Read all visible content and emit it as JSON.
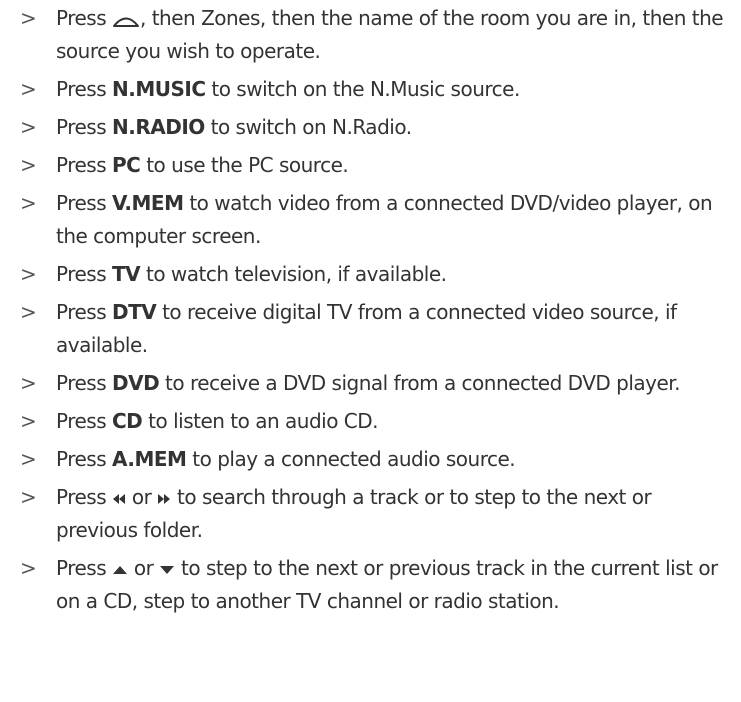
{
  "bullet": ">",
  "items": [
    {
      "pre": "Press ",
      "icon": "home-dome-icon",
      "post": ", then Zones, then the name of the room you are in, then the source you wish to operate."
    },
    {
      "pre": "Press ",
      "key": "N.MUSIC",
      "post": " to switch on the N.Music source."
    },
    {
      "pre": "Press ",
      "key": "N.RADIO",
      "post": " to switch on N.Radio."
    },
    {
      "pre": "Press ",
      "key": "PC",
      "post": " to use the PC source."
    },
    {
      "pre": "Press ",
      "key": "V.MEM",
      "post": " to watch video from a connected DVD/video player, on the computer screen."
    },
    {
      "pre": "Press ",
      "key": "TV",
      "post": " to watch television, if available."
    },
    {
      "pre": "Press ",
      "key": "DTV",
      "post": " to receive digital TV from a connected video source, if available."
    },
    {
      "pre": "Press ",
      "key": "DVD",
      "post": " to receive a DVD signal from a connected DVD player."
    },
    {
      "pre": "Press ",
      "key": "CD",
      "post": " to listen to an audio CD."
    },
    {
      "pre": "Press ",
      "key": "A.MEM",
      "post": " to play a connected audio source."
    },
    {
      "pre": "Press ",
      "icon": "rewind-icon",
      "mid": " or ",
      "icon2": "fast-forward-icon",
      "post": " to search through a track or to step to the next or previous folder."
    },
    {
      "pre": "Press ",
      "icon": "up-triangle-icon",
      "mid": " or ",
      "icon2": "down-triangle-icon",
      "post": " to step to the next or previous track in the current list or on a CD, step to another TV channel or radio station."
    }
  ]
}
